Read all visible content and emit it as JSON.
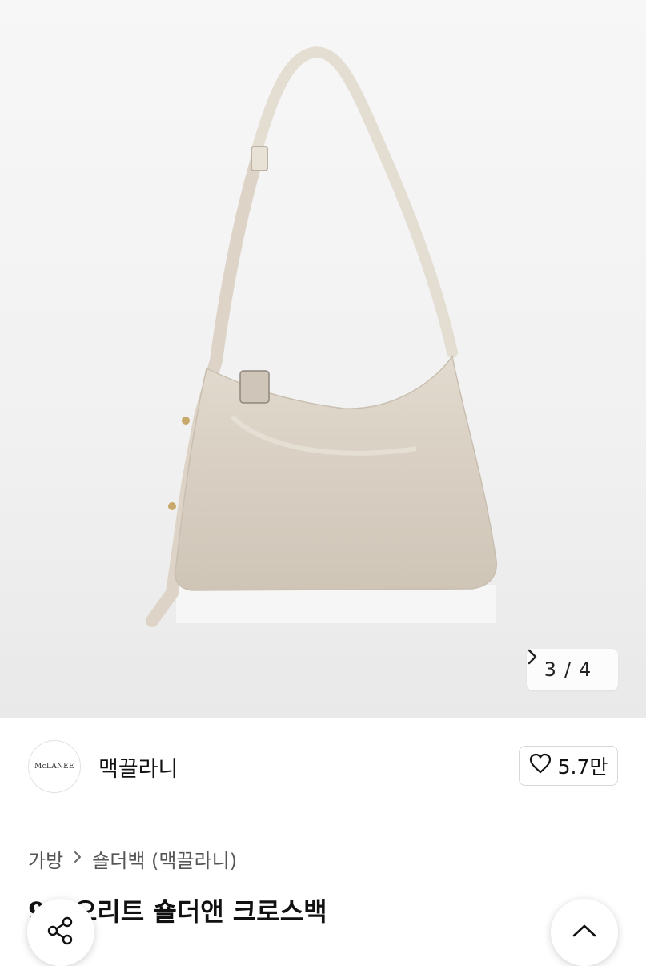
{
  "gallery": {
    "pager_current": "3",
    "pager_separator": "/",
    "pager_total": "4",
    "next_icon": "chevron-right-icon"
  },
  "seller": {
    "logo_text": "McLANEE",
    "name": "맥끌라니",
    "like_count": "5.7만",
    "like_icon": "heart-outline-icon"
  },
  "breadcrumb": {
    "items": [
      "가방",
      "숄더백 (맥끌라니)"
    ],
    "separator": ">"
  },
  "product": {
    "title": "9C 오리트 숄더앤 크로스백"
  },
  "fabs": {
    "share_icon": "share-icon",
    "scroll_top_icon": "chevron-up-icon"
  },
  "colors": {
    "bag": "#d9d0c3",
    "background": "#f1f1f1"
  }
}
